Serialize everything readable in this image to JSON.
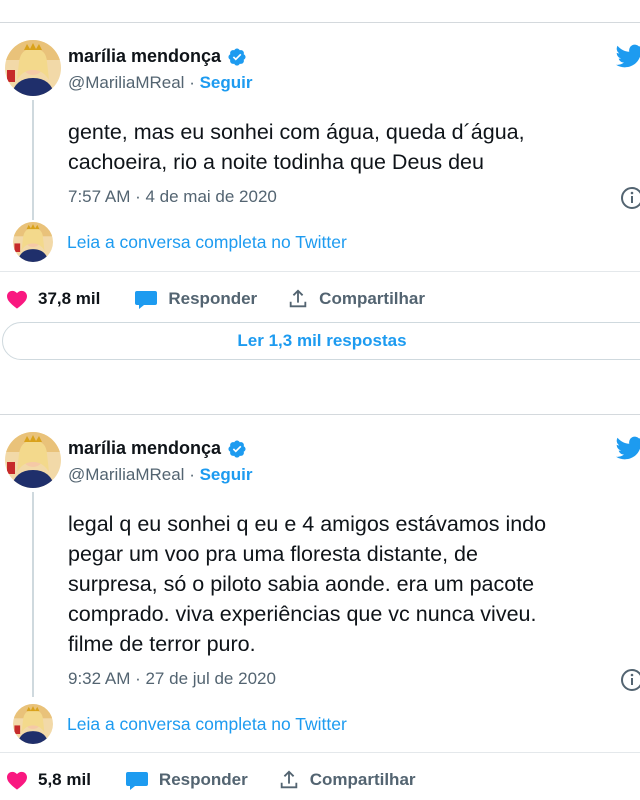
{
  "colors": {
    "accent": "#1d9bf0",
    "like": "#f91880",
    "text": "#0f1419",
    "muted": "#536471",
    "border": "#cfd9de"
  },
  "tweets": [
    {
      "name": "marília mendonça",
      "handle": "@MariliaMReal",
      "separator": "·",
      "follow_label": "Seguir",
      "text": "gente, mas eu sonhei com água, queda d´água,\ncachoeira, rio a noite todinha que Deus deu",
      "timestamp": "7:57 AM · 4 de mai de 2020",
      "conversation_link": "Leia a conversa completa no Twitter",
      "likes": "37,8 mil",
      "reply_label": "Responder",
      "share_label": "Compartilhar",
      "read_replies": "Ler 1,3 mil respostas",
      "icons": [
        "verified-badge-icon",
        "twitter-bird-icon",
        "info-icon",
        "heart-icon",
        "reply-bubble-icon",
        "share-icon"
      ]
    },
    {
      "name": "marília mendonça",
      "handle": "@MariliaMReal",
      "separator": "·",
      "follow_label": "Seguir",
      "text": "legal q eu sonhei q eu e 4 amigos estávamos indo\npegar um voo pra uma floresta distante, de\nsurpresa, só o piloto sabia aonde. era um pacote\ncomprado. viva experiências que vc nunca viveu.\nfilme de terror puro.",
      "timestamp": "9:32 AM · 27 de jul de 2020",
      "conversation_link": "Leia a conversa completa no Twitter",
      "likes": "5,8 mil",
      "reply_label": "Responder",
      "share_label": "Compartilhar",
      "icons": [
        "verified-badge-icon",
        "twitter-bird-icon",
        "info-icon",
        "heart-icon",
        "reply-bubble-icon",
        "share-icon"
      ]
    }
  ]
}
